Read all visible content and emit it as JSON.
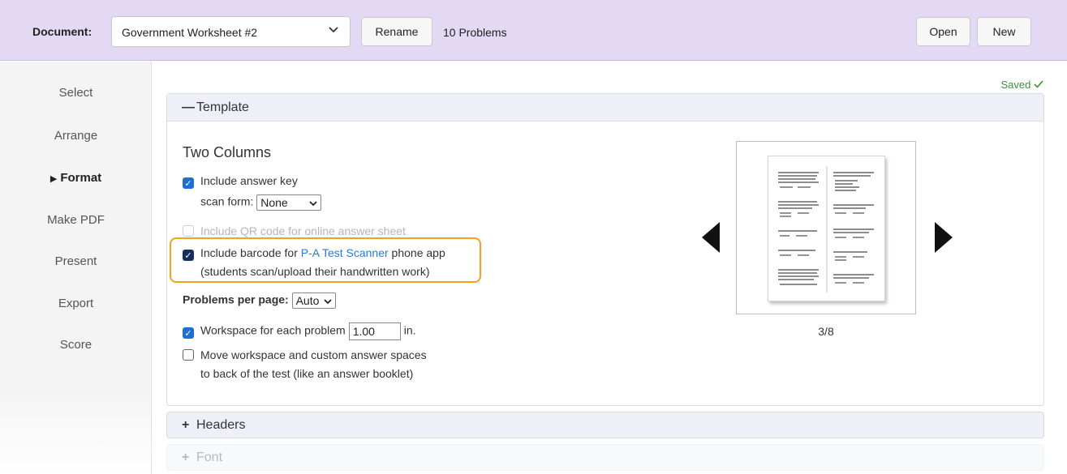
{
  "toolbar": {
    "document_label": "Document:",
    "document_selected": "Government Worksheet #2",
    "rename_label": "Rename",
    "problem_count": "10 Problems",
    "open_label": "Open",
    "new_label": "New"
  },
  "sidebar": {
    "items": [
      {
        "label": "Select",
        "active": false
      },
      {
        "label": "Arrange",
        "active": false
      },
      {
        "label": "Format",
        "active": true
      },
      {
        "label": "Make PDF",
        "active": false
      },
      {
        "label": "Present",
        "active": false
      },
      {
        "label": "Export",
        "active": false
      },
      {
        "label": "Score",
        "active": false
      }
    ]
  },
  "status": {
    "saved_label": "Saved"
  },
  "template": {
    "header": "Template",
    "name": "Two Columns",
    "answer_key": {
      "label": "Include answer key",
      "checked": true
    },
    "scan_form": {
      "label": "scan form:",
      "value": "None"
    },
    "qr_code": {
      "label": "Include QR code for online answer sheet",
      "enabled": false,
      "checked": false
    },
    "barcode": {
      "prefix": "Include barcode for ",
      "link": "P-A Test Scanner",
      "suffix": " phone app",
      "subtext": "(students scan/upload their handwritten work)",
      "checked": true
    },
    "problems_per_page": {
      "label": "Problems per page:",
      "value": "Auto"
    },
    "workspace": {
      "label": "Workspace for each problem",
      "value": "1.00",
      "unit": "in.",
      "checked": true
    },
    "move_workspace": {
      "line1": "Move workspace and custom answer spaces",
      "line2": "to back of the test (like an answer booklet)",
      "checked": false
    },
    "preview": {
      "page_indicator": "3/8"
    }
  },
  "sections": [
    {
      "label": "Headers"
    },
    {
      "label": "Font"
    }
  ],
  "colors": {
    "toolbar_bg": "#e3d9f5",
    "accent_blue": "#1f6fd1",
    "highlight_orange": "#f3a21b",
    "saved_green": "#3e8e3e",
    "link_blue": "#2a7bd6"
  }
}
